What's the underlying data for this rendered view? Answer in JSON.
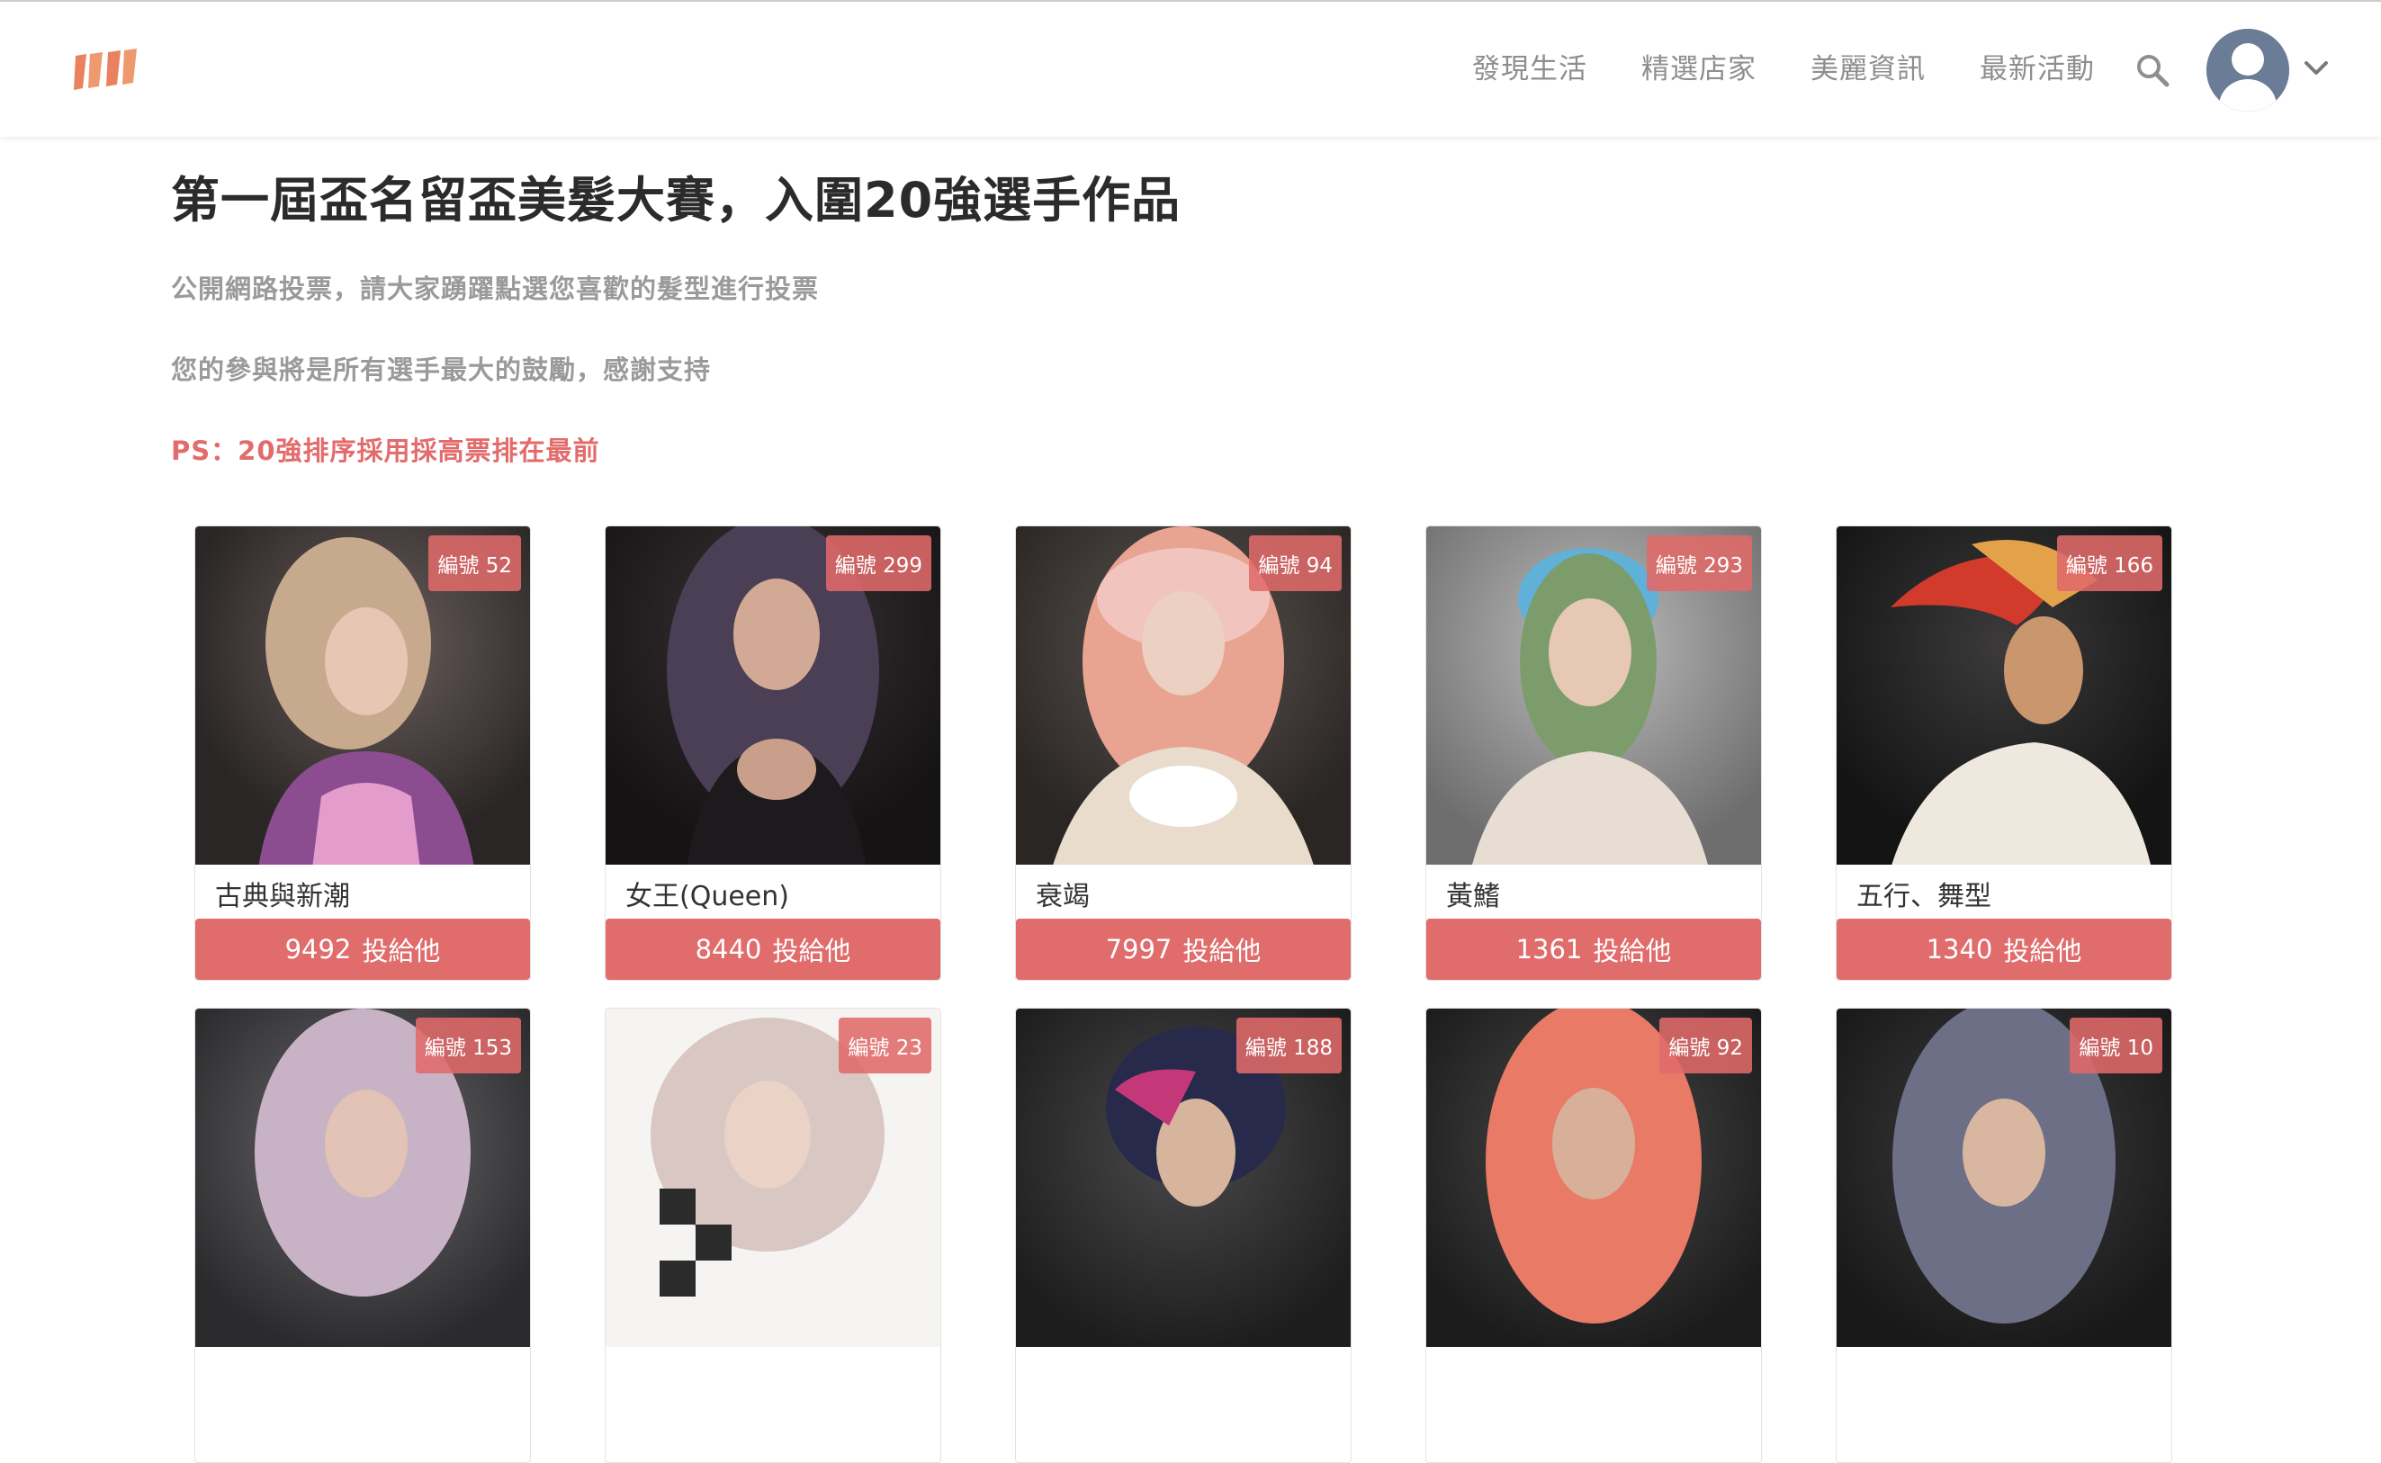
{
  "header": {
    "logo_icon": "brand-logo-icon",
    "nav": [
      "發現生活",
      "精選店家",
      "美麗資訊",
      "最新活動"
    ],
    "search_icon": "search-icon",
    "avatar_icon": "user-avatar-icon",
    "menu_icon": "chevron-down-icon",
    "brand_color": "#e8825f"
  },
  "intro": {
    "title": "第一屆盃名留盃美髮大賽，入圍20強選手作品",
    "line1": "公開網路投票，請大家踴躍點選您喜歡的髮型進行投票",
    "line2": "您的參與將是所有選手最大的鼓勵，感謝支持",
    "ps": "PS：20強排序採用採高票排在最前"
  },
  "vote_label": "投給他",
  "accent_color": "#e06c6c",
  "entries": [
    {
      "badge": "編號 52",
      "name": "古典與新潮",
      "votes": "9492"
    },
    {
      "badge": "編號 299",
      "name": "女王(Queen)",
      "votes": "8440"
    },
    {
      "badge": "編號 94",
      "name": "衰竭",
      "votes": "7997"
    },
    {
      "badge": "編號 293",
      "name": "黃鰭",
      "votes": "1361"
    },
    {
      "badge": "編號 166",
      "name": "五行、舞型",
      "votes": "1340"
    },
    {
      "badge": "編號 153"
    },
    {
      "badge": "編號 23"
    },
    {
      "badge": "編號 188"
    },
    {
      "badge": "編號 92"
    },
    {
      "badge": "編號 10"
    }
  ]
}
